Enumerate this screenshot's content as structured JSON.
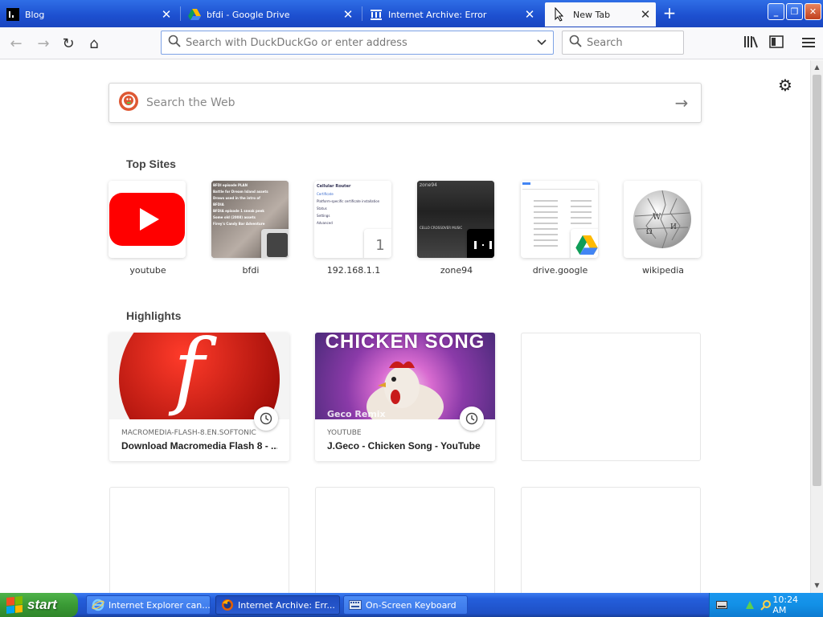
{
  "tabs": [
    {
      "title": "Blog",
      "close": "✕"
    },
    {
      "title": "bfdi - Google Drive",
      "close": "✕"
    },
    {
      "title": "Internet Archive: Error",
      "close": "✕"
    },
    {
      "title": "New Tab",
      "close": "✕"
    }
  ],
  "new_tab_symbol": "+",
  "window_controls": {
    "minimize": "_",
    "restore": "❐",
    "close": "✕"
  },
  "toolbar": {
    "back": "←",
    "forward": "→",
    "reload": "↻",
    "home": "⌂",
    "url_placeholder": "Search with DuckDuckGo or enter address",
    "search_placeholder": "Search",
    "dropdown": "⌄",
    "library": "|||\\",
    "sidebar": "▣",
    "menu": "≡"
  },
  "newtab": {
    "settings_icon": "⚙",
    "web_search_placeholder": "Search the Web",
    "web_search_go": "→",
    "top_sites_heading": "Top Sites",
    "highlights_heading": "Highlights",
    "top_sites": [
      {
        "label": "youtube"
      },
      {
        "label": "bfdi"
      },
      {
        "label": "192.168.1.1",
        "badge": "1"
      },
      {
        "label": "zone94"
      },
      {
        "label": "drive.google"
      },
      {
        "label": "wikipedia"
      }
    ],
    "highlights": [
      {
        "source": "MACROMEDIA-FLASH-8.EN.SOFTONIC",
        "title": "Download Macromedia Flash 8 - ...",
        "image_text": "f"
      },
      {
        "source": "YOUTUBE",
        "title": "J.Geco - Chicken Song - YouTube",
        "image_text": "CHICKEN SONG",
        "image_subtext": "Geco Remix"
      }
    ],
    "bfdi_thumb_lines": [
      "BFDI episode PLAN",
      "Battle for Dream Island assets",
      "Draws used in the intro of BFDIA",
      "BFDIA episode 1 sneak peek",
      "Some old (2008) assets",
      "Firey's Candy Bar Adventure"
    ],
    "router_thumb_lines": [
      "Cellular Router",
      "Certificate",
      "Platform-specific certificate installation",
      "Status",
      "Settings",
      "Advanced"
    ],
    "zone94_thumb_text": "zone94",
    "zone94_thumb_sub": "CELLO CROSSOVER MUSIC"
  },
  "taskbar": {
    "start": "start",
    "tasks": [
      {
        "label": "Internet Explorer can..."
      },
      {
        "label": "Internet Archive: Err..."
      },
      {
        "label": "On-Screen Keyboard"
      }
    ],
    "clock": "10:24 AM"
  },
  "colors": {
    "titlebar": "#1c4fcf",
    "youtube_red": "#ff0000",
    "flash_red": "#d4120d",
    "taskbar_blue": "#245edb",
    "start_green": "#3a9a35"
  }
}
